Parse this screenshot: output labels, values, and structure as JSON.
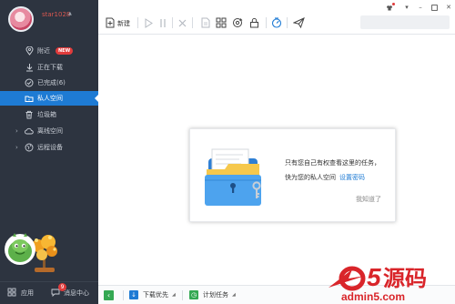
{
  "user": {
    "name": "star1028"
  },
  "sidebar": {
    "items": [
      {
        "label": "附近",
        "badge": "NEW",
        "icon": "location-pin-icon"
      },
      {
        "label": "正在下载",
        "icon": "download-icon"
      },
      {
        "label": "已完成(6)",
        "icon": "check-circle-icon"
      },
      {
        "label": "私人空间",
        "icon": "folder-lock-icon",
        "active": true
      },
      {
        "label": "垃圾箱",
        "icon": "trash-icon"
      },
      {
        "label": "离线空间",
        "icon": "cloud-icon",
        "expandable": true
      },
      {
        "label": "远程设备",
        "icon": "globe-icon",
        "expandable": true
      }
    ],
    "bottom": {
      "apps_label": "应用",
      "messages_label": "消息中心",
      "messages_count": "9"
    }
  },
  "toolbar": {
    "new_label": "新建",
    "icons": [
      "plus-icon",
      "play-icon",
      "pause-icon",
      "delete-icon",
      "document-icon",
      "grid-icon",
      "refresh-icon",
      "lock-icon",
      "speed-icon",
      "plane-icon"
    ]
  },
  "dialog": {
    "line1": "只有您自己有权查看这里的任务，",
    "line2": "快为您的私人空间",
    "link": "设置密码",
    "dismiss": "我知道了"
  },
  "statusbar": {
    "collapse_icon": "‹",
    "download_priority": "下载优先",
    "scheduled_tasks": "计划任务"
  },
  "watermark": {
    "brand_text": "a5源码",
    "url": "admin5.com"
  },
  "colors": {
    "sidebar_bg": "#2d3440",
    "accent": "#1e7bd4",
    "badge_red": "#e03b3b",
    "status_green": "#34a853"
  }
}
